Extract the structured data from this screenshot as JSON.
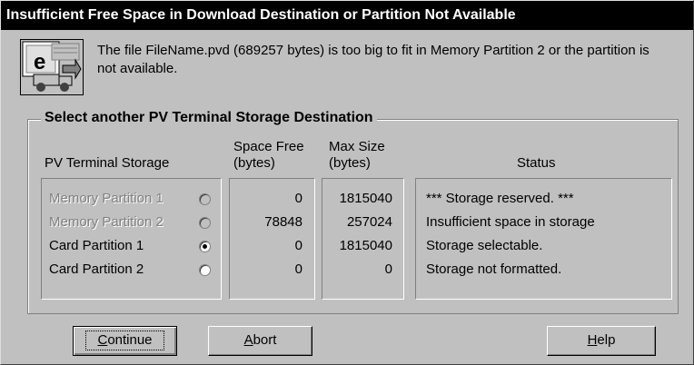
{
  "dialog": {
    "title": "Insufficient Free Space in Download Destination or Partition Not Available",
    "message": "The file FileName.pvd (689257 bytes) is too big to fit in Memory Partition 2 or the partition is not available.",
    "icon": "terminal-download-icon"
  },
  "group": {
    "legend": "Select another PV Terminal Storage Destination",
    "headers": {
      "storage": "PV Terminal Storage",
      "space_free": "Space Free (bytes)",
      "max_size": "Max Size (bytes)",
      "status": "Status"
    },
    "rows": [
      {
        "name": "Memory Partition 1",
        "enabled": false,
        "selected": false,
        "space_free": "0",
        "max_size": "1815040",
        "status": "*** Storage reserved. ***"
      },
      {
        "name": "Memory Partition 2",
        "enabled": false,
        "selected": false,
        "space_free": "78848",
        "max_size": "257024",
        "status": "Insufficient space in storage"
      },
      {
        "name": "Card Partition 1",
        "enabled": true,
        "selected": true,
        "space_free": "0",
        "max_size": "1815040",
        "status": "Storage selectable."
      },
      {
        "name": "Card Partition 2",
        "enabled": true,
        "selected": false,
        "space_free": "0",
        "max_size": "0",
        "status": "Storage not formatted."
      }
    ]
  },
  "buttons": {
    "continue_prefix": "",
    "continue_ul": "C",
    "continue_rest": "ontinue",
    "abort_ul": "A",
    "abort_rest": "bort",
    "help_ul": "H",
    "help_rest": "elp"
  }
}
